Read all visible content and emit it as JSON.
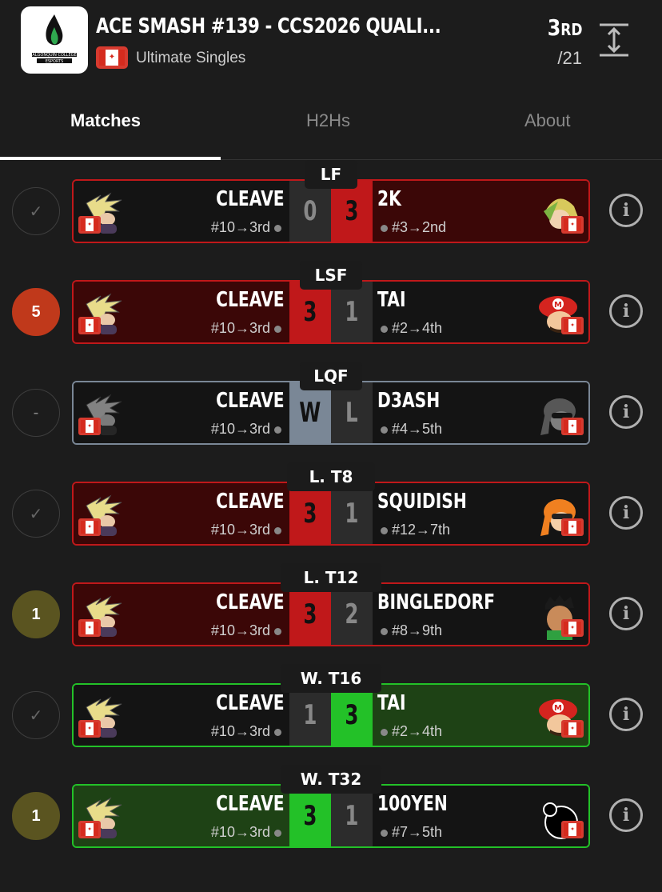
{
  "header": {
    "title": "ACE SMASH #139 - CCS2026 QUALI...",
    "subtitle": "Ultimate Singles",
    "rank": "3",
    "rank_suffix": "RD",
    "total": "/21",
    "logo_text_line1": "ALGONQUIN COLLEGE",
    "logo_text_line2": "ESPORTS"
  },
  "tabs": [
    {
      "label": "Matches",
      "active": true
    },
    {
      "label": "H2Hs",
      "active": false
    },
    {
      "label": "About",
      "active": false
    }
  ],
  "colors": {
    "loss_red": "#c0181a",
    "loss_dark": "#3b0707",
    "win_green": "#23c128",
    "win_dark": "#1e4215",
    "dq_grey": "#7a8796",
    "seed_orange": "#c0391b",
    "seed_olive": "#5a5420"
  },
  "matches": [
    {
      "round": "LF",
      "circle": "✓",
      "circle_type": "check",
      "left_name": "CLEAVE",
      "left_seed": "#10→3rd",
      "left_score": "0",
      "right_score": "3",
      "right_name": "2K",
      "right_seed": "#3→2nd",
      "left_char": "cloud-icon",
      "right_char": "link-icon",
      "outcome": "loss"
    },
    {
      "round": "LSF",
      "circle": "5",
      "circle_type": "orange",
      "left_name": "CLEAVE",
      "left_seed": "#10→3rd",
      "left_score": "3",
      "right_score": "1",
      "right_name": "TAI",
      "right_seed": "#2→4th",
      "left_char": "cloud-icon",
      "right_char": "mario-icon",
      "outcome": "loss-win-left"
    },
    {
      "round": "LQF",
      "circle": "-",
      "circle_type": "dash",
      "left_name": "CLEAVE",
      "left_seed": "#10→3rd",
      "left_score": "W",
      "right_score": "L",
      "right_name": "D3ASH",
      "right_seed": "#4→5th",
      "left_char": "cloud-icon",
      "right_char": "inkling-icon",
      "outcome": "dq"
    },
    {
      "round": "L. T8",
      "circle": "✓",
      "circle_type": "check",
      "left_name": "CLEAVE",
      "left_seed": "#10→3rd",
      "left_score": "3",
      "right_score": "1",
      "right_name": "SQUIDISH",
      "right_seed": "#12→7th",
      "left_char": "cloud-icon",
      "right_char": "inkling-icon",
      "outcome": "loss-win-left"
    },
    {
      "round": "L. T12",
      "circle": "1",
      "circle_type": "olive",
      "left_name": "CLEAVE",
      "left_seed": "#10→3rd",
      "left_score": "3",
      "right_score": "2",
      "right_name": "BINGLEDORF",
      "right_seed": "#8→9th",
      "left_char": "cloud-icon",
      "right_char": "little-mac-icon",
      "outcome": "loss-win-left"
    },
    {
      "round": "W. T16",
      "circle": "✓",
      "circle_type": "check",
      "left_name": "CLEAVE",
      "left_seed": "#10→3rd",
      "left_score": "1",
      "right_score": "3",
      "right_name": "TAI",
      "right_seed": "#2→4th",
      "left_char": "cloud-icon",
      "right_char": "mario-icon",
      "outcome": "win-right"
    },
    {
      "round": "W. T32",
      "circle": "1",
      "circle_type": "olive",
      "left_name": "CLEAVE",
      "left_seed": "#10→3rd",
      "left_score": "3",
      "right_score": "1",
      "right_name": "100YEN",
      "right_seed": "#7→5th",
      "left_char": "cloud-icon",
      "right_char": "random-icon",
      "outcome": "win-left"
    }
  ]
}
